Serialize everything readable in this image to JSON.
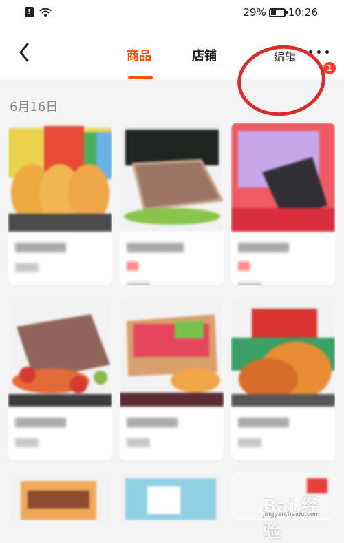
{
  "status_bar": {
    "alert": "!",
    "battery": "29%",
    "time": "10:26",
    "battery_level": 0.29
  },
  "header": {
    "back_icon": "chevron-left-icon",
    "tabs": [
      "商品",
      "店铺"
    ],
    "active_tab": "商品",
    "edit": "编辑",
    "more_icon": "more-dots-icon",
    "badge": "1"
  },
  "section": {
    "date": "6月16日"
  },
  "products": [
    {
      "name_label": "",
      "price": "",
      "meta": ""
    },
    {
      "name_label": "",
      "price": "",
      "meta": ""
    },
    {
      "name_label": "",
      "price": "",
      "meta": ""
    },
    {
      "name_label": "",
      "price": "",
      "meta": ""
    },
    {
      "name_label": "",
      "price": "",
      "meta": ""
    },
    {
      "name_label": "",
      "price": "",
      "meta": ""
    }
  ],
  "watermark": {
    "text": "Bai 经验",
    "site": "jingyan.baidu.com"
  },
  "colors": {
    "accent": "#ff5000",
    "annotation": "#d72d2d"
  }
}
